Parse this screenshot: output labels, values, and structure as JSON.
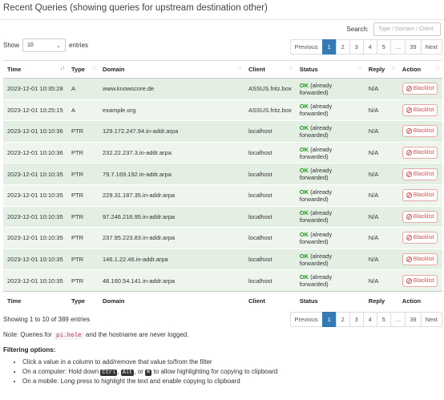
{
  "header": {
    "title": "Recent Queries (showing queries for upstream destination other)"
  },
  "search": {
    "label": "Search:",
    "placeholder": "Type / Domain / Client"
  },
  "length": {
    "show_label": "Show",
    "value": "10",
    "entries_label": "entries"
  },
  "pagination": {
    "previous": "Previous",
    "pages": [
      "1",
      "2",
      "3",
      "4",
      "5",
      "…",
      "39"
    ],
    "active_page": "1",
    "next": "Next"
  },
  "table": {
    "columns": [
      "Time",
      "Type",
      "Domain",
      "Client",
      "Status",
      "Reply",
      "Action"
    ],
    "action_label": "Blacklist",
    "rows": [
      {
        "time": "2023-12-01 10:35:28",
        "type": "A",
        "domain": "www.knowscore.de",
        "client": "ASSUS.fritz.box",
        "status_ok": "OK",
        "status_text": "(already forwarded)",
        "reply": "N/A"
      },
      {
        "time": "2023-12-01 10:25:15",
        "type": "A",
        "domain": "example.org",
        "client": "ASSUS.fritz.box",
        "status_ok": "OK",
        "status_text": "(already forwarded)",
        "reply": "N/A"
      },
      {
        "time": "2023-12-01 10:10:36",
        "type": "PTR",
        "domain": "129.172.247.94.in-addr.arpa",
        "client": "localhost",
        "status_ok": "OK",
        "status_text": "(already forwarded)",
        "reply": "N/A"
      },
      {
        "time": "2023-12-01 10:10:36",
        "type": "PTR",
        "domain": "232.22.237.3.in-addr.arpa",
        "client": "localhost",
        "status_ok": "OK",
        "status_text": "(already forwarded)",
        "reply": "N/A"
      },
      {
        "time": "2023-12-01 10:10:35",
        "type": "PTR",
        "domain": "79.7.169.192.in-addr.arpa",
        "client": "localhost",
        "status_ok": "OK",
        "status_text": "(already forwarded)",
        "reply": "N/A"
      },
      {
        "time": "2023-12-01 10:10:35",
        "type": "PTR",
        "domain": "229.31.187.35.in-addr.arpa",
        "client": "localhost",
        "status_ok": "OK",
        "status_text": "(already forwarded)",
        "reply": "N/A"
      },
      {
        "time": "2023-12-01 10:10:35",
        "type": "PTR",
        "domain": "97.246.216.95.in-addr.arpa",
        "client": "localhost",
        "status_ok": "OK",
        "status_text": "(already forwarded)",
        "reply": "N/A"
      },
      {
        "time": "2023-12-01 10:10:35",
        "type": "PTR",
        "domain": "237.95.223.83.in-addr.arpa",
        "client": "localhost",
        "status_ok": "OK",
        "status_text": "(already forwarded)",
        "reply": "N/A"
      },
      {
        "time": "2023-12-01 10:10:35",
        "type": "PTR",
        "domain": "146.1.22.46.in-addr.arpa",
        "client": "localhost",
        "status_ok": "OK",
        "status_text": "(already forwarded)",
        "reply": "N/A"
      },
      {
        "time": "2023-12-01 10:10:35",
        "type": "PTR",
        "domain": "48.160.54.141.in-addr.arpa",
        "client": "localhost",
        "status_ok": "OK",
        "status_text": "(already forwarded)",
        "reply": "N/A"
      }
    ]
  },
  "footer": {
    "info": "Showing 1 to 10 of 389 entries",
    "note_prefix": "Note: Queries for",
    "note_code": "pi.hole",
    "note_suffix": "and the hostname are never logged.",
    "filter_title": "Filtering options:",
    "tip1": "Click a value in a column to add/remove that value to/from the filter",
    "tip2_prefix": "On a computer: Hold down",
    "key_ctrl": "Ctrl",
    "key_alt": "Alt",
    "key_meta": "⌘",
    "tip2_comma": ",",
    "tip2_or": ", or",
    "tip2_suffix": "to allow highlighting for copying to clipboard",
    "tip3": "On a mobile: Long press to highlight the text and enable copying to clipboard"
  },
  "colors": {
    "accent": "#337ab7",
    "ok": "#2b8a2b",
    "row_odd": "#e4efe3",
    "row_even": "#edf5ec",
    "danger": "#d9534f"
  }
}
